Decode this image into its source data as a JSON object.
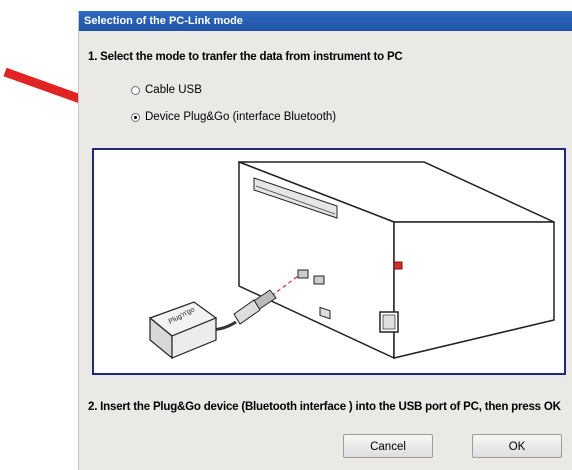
{
  "dialog": {
    "title": "Selection of the PC-Link mode",
    "step1": "1.  Select the mode to tranfer the data from instrument to PC",
    "options": [
      {
        "label": "Cable USB",
        "checked": false
      },
      {
        "label": "Device Plug&Go (interface Bluetooth)",
        "checked": true
      }
    ],
    "illustration": {
      "device_label": "Plug'n'go"
    },
    "step2": "2.  Insert the Plug&Go device (Bluetooth interface ) into the USB port of PC, then press OK",
    "buttons": {
      "cancel": "Cancel",
      "ok": "OK"
    }
  },
  "annotation": {
    "arrow_color": "#e02424"
  },
  "colors": {
    "titlebar": "#2660b6",
    "image_border": "#1d2a7c",
    "dialog_bg": "#ebe9e6"
  }
}
